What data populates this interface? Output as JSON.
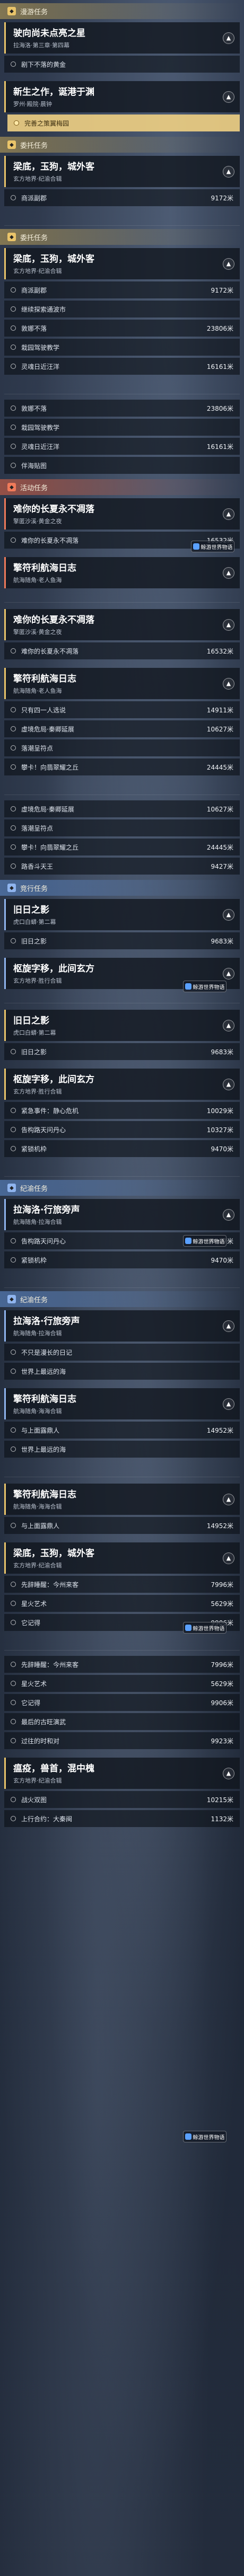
{
  "frames": [
    {
      "sections": [
        {
          "label": "漫游任务",
          "color": "gold",
          "quests": [
            {
              "title": "驶向尚未点亮之星",
              "sub": "拉海洛·第三章·第四幕",
              "collapse": "▲",
              "objectives": [
                {
                  "text": "剧下不落的黄金",
                  "dist": ""
                }
              ]
            },
            {
              "title": "新生之作，诞港于渊",
              "sub": "罗州·殿院·晨钟",
              "collapse": "▲",
              "objectives": [
                {
                  "text": "完善之策翼梅园",
                  "dist": "",
                  "highlight": true
                }
              ]
            }
          ]
        },
        {
          "label": "委托任务",
          "color": "gold",
          "quests": [
            {
              "title": "梁底，玉狗，城外客",
              "sub": "玄方地界·纪渝合辑",
              "collapse": "▲",
              "objectives": [
                {
                  "text": "商派副郡",
                  "dist": "9172米"
                }
              ]
            }
          ]
        }
      ]
    },
    {
      "sections": [
        {
          "label": "委托任务",
          "color": "gold",
          "quests": [
            {
              "title": "梁底，玉狗，城外客",
              "sub": "玄方地界·纪渝合辑",
              "collapse": "▲",
              "objectives": [
                {
                  "text": "商派副郡",
                  "dist": "9172米"
                },
                {
                  "text": "继续探索通波市",
                  "dist": ""
                },
                {
                  "text": "敦娜不落",
                  "dist": "23806米"
                },
                {
                  "text": "栽园驾驶教学",
                  "dist": ""
                },
                {
                  "text": "灵魂日近汪洋",
                  "dist": "16161米"
                }
              ]
            }
          ]
        }
      ]
    },
    {
      "sections": [
        {
          "label": "",
          "color": "none",
          "quests": [
            {
              "title": "",
              "sub": "",
              "collapse": "",
              "objectives": [
                {
                  "text": "敦娜不落",
                  "dist": "23806米"
                },
                {
                  "text": "栽园驾驶教学",
                  "dist": ""
                },
                {
                  "text": "灵魂日近汪洋",
                  "dist": "16161米"
                },
                {
                  "text": "伴海贴图",
                  "dist": ""
                }
              ]
            }
          ]
        },
        {
          "label": "活动任务",
          "color": "red",
          "quests": [
            {
              "title": "难你的长夏永不凋落",
              "sub": "擎匿沙溪·黄金之夜",
              "collapse": "▲",
              "objectives": [
                {
                  "text": "难你的长夏永不凋落",
                  "dist": "16532米"
                }
              ]
            },
            {
              "title": "擎符利航海日志",
              "sub": "航海随角·老人鱼海",
              "collapse": "▲",
              "objectives": []
            }
          ]
        }
      ]
    },
    {
      "sections": [
        {
          "label": "",
          "color": "none",
          "quests": [
            {
              "title": "难你的长夏永不凋落",
              "sub": "擎匿沙溪·黄金之夜",
              "collapse": "▲",
              "objectives": [
                {
                  "text": "难你的长夏永不凋落",
                  "dist": "16532米"
                }
              ]
            },
            {
              "title": "擎符利航海日志",
              "sub": "航海随角·老人鱼海",
              "collapse": "▲",
              "objectives": [
                {
                  "text": "只有四一人选说",
                  "dist": "14911米"
                },
                {
                  "text": "虚境危局·秦卿延展",
                  "dist": "10627米"
                },
                {
                  "text": "落潮呈符点",
                  "dist": ""
                },
                {
                  "text": "攀卡！向翡翠耀之丘",
                  "dist": "24445米"
                }
              ]
            }
          ]
        }
      ]
    },
    {
      "sections": [
        {
          "label": "",
          "color": "none",
          "quests": [
            {
              "title": "",
              "sub": "",
              "collapse": "",
              "objectives": [
                {
                  "text": "虚境危局·秦卿延展",
                  "dist": "10627米"
                },
                {
                  "text": "落潮呈符点",
                  "dist": ""
                },
                {
                  "text": "攀卡！向翡翠耀之丘",
                  "dist": "24445米"
                },
                {
                  "text": "路香斗天王",
                  "dist": "9427米"
                }
              ]
            }
          ]
        },
        {
          "label": "竞行任务",
          "color": "blue",
          "quests": [
            {
              "title": "旧日之影",
              "sub": "虎口白蟒·第二幕",
              "collapse": "▲",
              "objectives": [
                {
                  "text": "旧日之影",
                  "dist": "9683米"
                }
              ]
            },
            {
              "title": "枢旋字移，此间玄方",
              "sub": "玄方地界·胜行合辑",
              "collapse": "▲",
              "objectives": []
            }
          ]
        }
      ]
    },
    {
      "sections": [
        {
          "label": "",
          "color": "none",
          "quests": [
            {
              "title": "旧日之影",
              "sub": "虎口白蟒·第二幕",
              "collapse": "▲",
              "objectives": [
                {
                  "text": "旧日之影",
                  "dist": "9683米"
                }
              ]
            },
            {
              "title": "枢旋字移，此间玄方",
              "sub": "玄方地界·胜行合辑",
              "collapse": "▲",
              "objectives": [
                {
                  "text": "紧急事件：静心危机",
                  "dist": "10029米"
                },
                {
                  "text": "告构路天问丹心",
                  "dist": "10327米"
                },
                {
                  "text": "紧锁机枠",
                  "dist": "9470米"
                }
              ]
            }
          ]
        }
      ]
    },
    {
      "sections": [
        {
          "label": "纪渝任务",
          "color": "blue",
          "quests": [
            {
              "title": "拉海洛·行旅旁声",
              "sub": "航海随角·拉海合辑",
              "collapse": "▲",
              "objectives": [
                {
                  "text": "告构路天问丹心",
                  "dist": "10327米"
                },
                {
                  "text": "紧锁机枠",
                  "dist": "9470米"
                }
              ]
            }
          ]
        }
      ]
    },
    {
      "sections": [
        {
          "label": "纪渝任务",
          "color": "blue",
          "quests": [
            {
              "title": "拉海洛·行旅旁声",
              "sub": "航海随角·拉海合辑",
              "collapse": "▲",
              "objectives": [
                {
                  "text": "不只是漫长的日记",
                  "dist": ""
                },
                {
                  "text": "世界上最远的海",
                  "dist": ""
                }
              ]
            },
            {
              "title": "擎符利航海日志",
              "sub": "航海随角·海海合辑",
              "collapse": "▲",
              "objectives": [
                {
                  "text": "与上面露鼎人",
                  "dist": "14952米"
                },
                {
                  "text": "世界上最远的海",
                  "dist": ""
                }
              ]
            }
          ]
        }
      ]
    },
    {
      "sections": [
        {
          "label": "",
          "color": "none",
          "quests": [
            {
              "title": "擎符利航海日志",
              "sub": "航海随角·海海合辑",
              "collapse": "▲",
              "objectives": [
                {
                  "text": "与上面露鼎人",
                  "dist": "14952米"
                }
              ]
            },
            {
              "title": "梁底，玉狗，城外客",
              "sub": "玄方地界·纪渝合辑",
              "collapse": "▲",
              "objectives": [
                {
                  "text": "先辞睡醒：今州来客",
                  "dist": "7996米"
                },
                {
                  "text": "星火艺术",
                  "dist": "5629米"
                },
                {
                  "text": "它记得",
                  "dist": "9906米"
                }
              ]
            }
          ]
        }
      ]
    },
    {
      "sections": [
        {
          "label": "",
          "color": "none",
          "quests": [
            {
              "title": "",
              "sub": "",
              "collapse": "",
              "objectives": [
                {
                  "text": "先辞睡醒：今州来客",
                  "dist": "7996米"
                },
                {
                  "text": "星火艺术",
                  "dist": "5629米"
                },
                {
                  "text": "它记得",
                  "dist": "9906米"
                },
                {
                  "text": "最后的古旺演武",
                  "dist": ""
                },
                {
                  "text": "过往的时和对",
                  "dist": "9923米"
                }
              ]
            },
            {
              "title": "瘟疫，兽首，混中槐",
              "sub": "玄方地界·纪渝合辑",
              "collapse": "▲",
              "objectives": [
                {
                  "text": "战火双图",
                  "dist": "10215米"
                },
                {
                  "text": "上行合约：大秦闽",
                  "dist": "1132米"
                }
              ]
            }
          ]
        }
      ]
    }
  ],
  "watermark": {
    "text": "鲸游世界物语"
  },
  "colors": {
    "gold": "#e9c46a",
    "red": "#f07a5a",
    "blue": "#8fb4ee"
  }
}
